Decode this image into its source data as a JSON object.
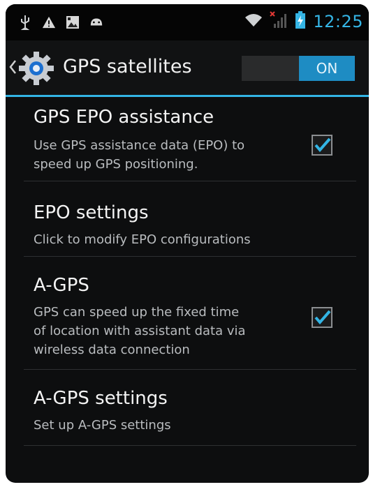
{
  "status_bar": {
    "time": "12:25",
    "icons": [
      "usb-icon",
      "warning-icon",
      "image-notification-icon",
      "android-debug-icon",
      "wifi-icon",
      "no-signal-icon",
      "battery-charging-icon"
    ]
  },
  "action_bar": {
    "title": "GPS satellites",
    "toggle_label": "ON",
    "icon": "gear-icon"
  },
  "items": [
    {
      "title": "GPS EPO assistance",
      "subtitle_lines": [
        "Use GPS assistance data (EPO) to",
        "speed up GPS positioning."
      ],
      "checked": true
    },
    {
      "title": "EPO settings",
      "subtitle_lines": [
        "Click to modify EPO configurations"
      ]
    },
    {
      "title": "A-GPS",
      "subtitle_lines": [
        "GPS can speed up the fixed time",
        "of location with assistant data via",
        "wireless data connection"
      ],
      "checked": true
    },
    {
      "title": "A-GPS settings",
      "subtitle_lines": [
        "Set up A-GPS settings"
      ]
    }
  ],
  "colors": {
    "accent": "#33b5e5",
    "background": "#0d0e0f",
    "toggle_on": "#1e8cc3"
  }
}
